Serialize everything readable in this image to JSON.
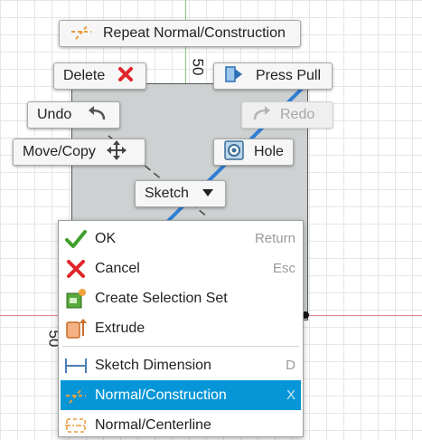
{
  "canvas": {
    "dimension_label_top": "50",
    "dimension_label_left": "50"
  },
  "marking_menu": {
    "repeat_label": "Repeat Normal/Construction",
    "delete_label": "Delete",
    "press_pull_label": "Press Pull",
    "undo_label": "Undo",
    "redo_label": "Redo",
    "move_copy_label": "Move/Copy",
    "hole_label": "Hole",
    "sketch_label": "Sketch"
  },
  "context_menu": {
    "items": [
      {
        "label": "OK",
        "shortcut": "Return",
        "icon": "checkmark-icon"
      },
      {
        "label": "Cancel",
        "shortcut": "Esc",
        "icon": "cancel-x-icon"
      },
      {
        "label": "Create Selection Set",
        "shortcut": "",
        "icon": "selection-set-icon"
      },
      {
        "label": "Extrude",
        "shortcut": "",
        "icon": "extrude-icon"
      },
      {
        "label": "Sketch Dimension",
        "shortcut": "D",
        "icon": "sketch-dimension-icon"
      },
      {
        "label": "Normal/Construction",
        "shortcut": "X",
        "icon": "construction-line-icon",
        "selected": true
      },
      {
        "label": "Normal/Centerline",
        "shortcut": "",
        "icon": "centerline-icon"
      }
    ]
  },
  "colors": {
    "accent_selected": "#0696d7",
    "delete_red": "#e0262b",
    "ok_green": "#3f9f2b",
    "sketch_line_blue": "#2f7fd6"
  }
}
